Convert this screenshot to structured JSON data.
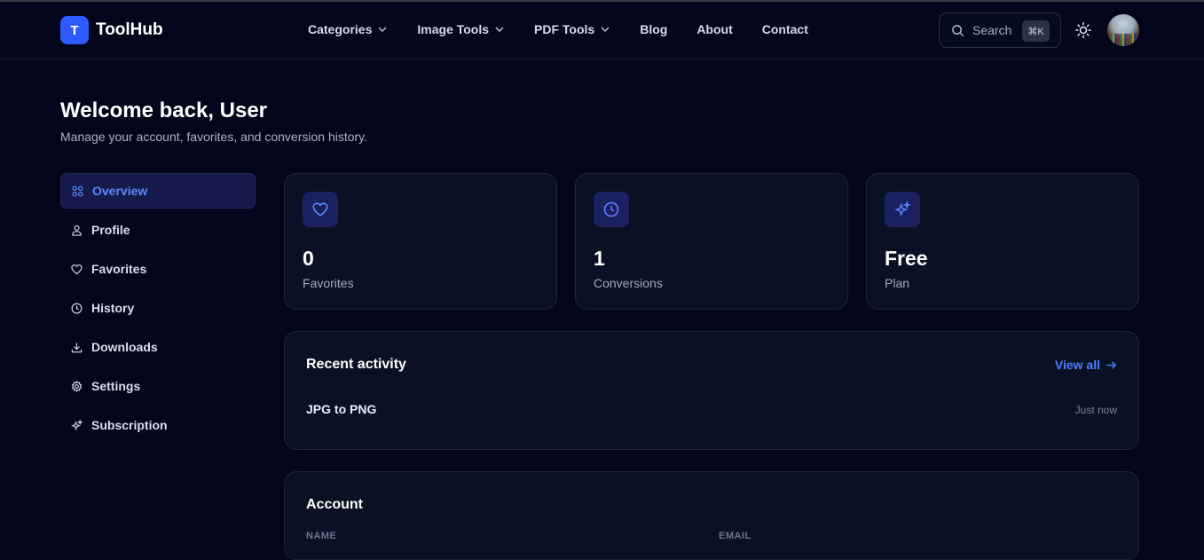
{
  "brand": {
    "logo_letter": "T",
    "name": "ToolHub",
    "accent": "#2d5bff"
  },
  "nav": {
    "items": [
      {
        "label": "Categories",
        "has_dropdown": true
      },
      {
        "label": "Image Tools",
        "has_dropdown": true
      },
      {
        "label": "PDF Tools",
        "has_dropdown": true
      },
      {
        "label": "Blog",
        "has_dropdown": false
      },
      {
        "label": "About",
        "has_dropdown": false
      },
      {
        "label": "Contact",
        "has_dropdown": false
      }
    ]
  },
  "search": {
    "label": "Search",
    "shortcut": "⌘K",
    "icon": "search-icon"
  },
  "header_actions": {
    "theme_icon": "sun-icon",
    "avatar": "user-avatar"
  },
  "page": {
    "title": "Welcome back, User",
    "subtitle": "Manage your account, favorites, and conversion history."
  },
  "sidebar": {
    "items": [
      {
        "label": "Overview",
        "icon": "grid-icon",
        "active": true
      },
      {
        "label": "Profile",
        "icon": "user-icon",
        "active": false
      },
      {
        "label": "Favorites",
        "icon": "heart-icon",
        "active": false
      },
      {
        "label": "History",
        "icon": "clock-icon",
        "active": false
      },
      {
        "label": "Downloads",
        "icon": "download-icon",
        "active": false
      },
      {
        "label": "Settings",
        "icon": "gear-icon",
        "active": false
      },
      {
        "label": "Subscription",
        "icon": "sparkles-icon",
        "active": false
      }
    ]
  },
  "stats": [
    {
      "value": "0",
      "label": "Favorites",
      "icon": "heart-icon"
    },
    {
      "value": "1",
      "label": "Conversions",
      "icon": "clock-icon"
    },
    {
      "value": "Free",
      "label": "Plan",
      "icon": "sparkles-icon"
    }
  ],
  "activity": {
    "title": "Recent activity",
    "view_all": "View all",
    "items": [
      {
        "name": "JPG to PNG",
        "time": "Just now"
      }
    ]
  },
  "account": {
    "title": "Account",
    "fields": [
      {
        "label": "NAME"
      },
      {
        "label": "EMAIL"
      }
    ]
  }
}
